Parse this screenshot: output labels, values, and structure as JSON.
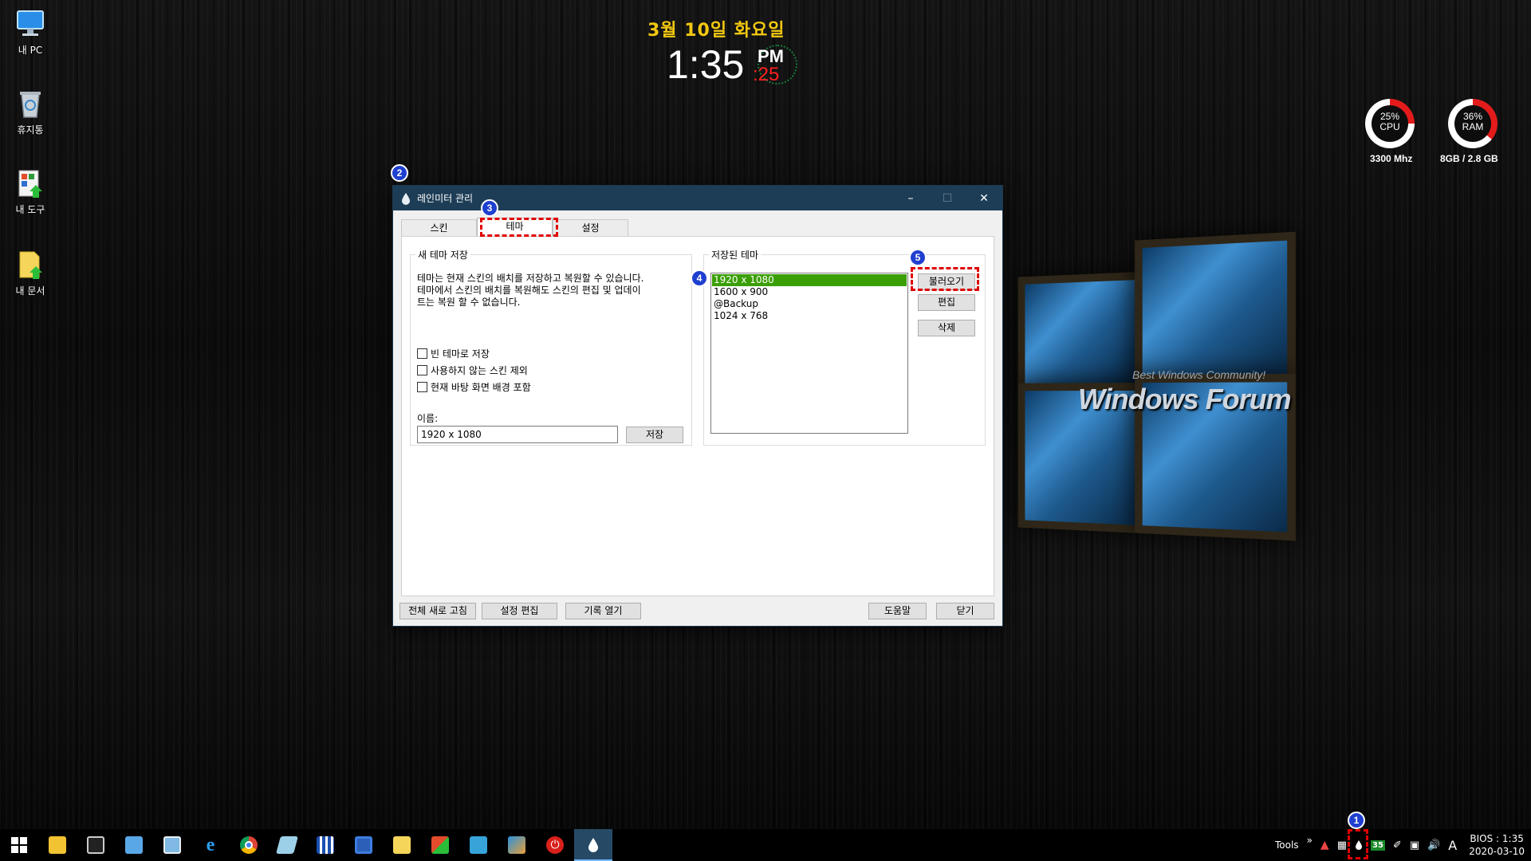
{
  "desktop": {
    "icons": [
      {
        "label": "내 PC",
        "icon": "computer-icon"
      },
      {
        "label": "휴지통",
        "icon": "recycle-bin-icon"
      },
      {
        "label": "내 도구",
        "icon": "tools-folder-icon"
      },
      {
        "label": "내 문서",
        "icon": "documents-folder-icon"
      }
    ]
  },
  "clock_widget": {
    "date": "3월 10일 화요일",
    "time": "1:35",
    "ampm": "PM",
    "seconds": ":25"
  },
  "gauges": {
    "cpu": {
      "percent_label": "25%",
      "name": "CPU",
      "sub": "3300 Mhz",
      "value": 0.25,
      "color": "#e31b1b"
    },
    "ram": {
      "percent_label": "36%",
      "name": "RAM",
      "sub": "8GB /  2.8 GB",
      "value": 0.36,
      "color": "#e31b1b"
    }
  },
  "wallpaper": {
    "tagline": "Best Windows Community!",
    "brand": "Windows Forum"
  },
  "markers": [
    "1",
    "2",
    "3",
    "4",
    "5"
  ],
  "dialog": {
    "title": "레인미터 관리",
    "tabs": [
      "스킨",
      "테마",
      "설정"
    ],
    "active_tab": "테마",
    "new_theme": {
      "group_title": "새 테마 저장",
      "description_lines": [
        "테마는 현재 스킨의 배치를 저장하고 복원할 수 있습니다.",
        "테마에서 스킨의 배치를 복원해도 스킨의 편집 및 업데이",
        "트는 복원 할 수 없습니다."
      ],
      "options": [
        {
          "label": "빈 테마로 저장",
          "checked": false
        },
        {
          "label": "사용하지 않는 스킨 제외",
          "checked": false
        },
        {
          "label": "현재 바탕 화면 배경 포함",
          "checked": false
        }
      ],
      "name_label": "이름:",
      "name_value": "1920 x 1080",
      "save_button": "저장"
    },
    "saved_themes": {
      "group_title": "저장된 테마",
      "items": [
        "1920 x 1080",
        "1600 x 900",
        "@Backup",
        "1024 x 768"
      ],
      "selected": "1920 x 1080",
      "load_button": "불러오기",
      "edit_button": "편집",
      "delete_button": "삭제"
    },
    "footer": {
      "refresh_all": "전체 새로 고침",
      "edit_settings": "설정 편집",
      "open_log": "기록 열기",
      "help": "도움말",
      "close": "닫기"
    }
  },
  "taskbar": {
    "apps": [
      "windows-start-icon",
      "file-explorer-icon",
      "terminal-icon",
      "notebook-icon",
      "remote-desktop-icon",
      "internet-explorer-icon",
      "chrome-icon",
      "eraser-icon",
      "qr-tool-icon",
      "save-disk-icon",
      "notepad-up-icon",
      "tools-green-icon",
      "drive-icon",
      "book-icon",
      "power-icon",
      "rainmeter-icon"
    ],
    "tray": {
      "tools_label": "Tools",
      "overflow": "»",
      "temp_badge": "35",
      "ime": "A",
      "clock_line1": "BIOS : 1:35",
      "clock_line2": "2020-03-10"
    }
  }
}
